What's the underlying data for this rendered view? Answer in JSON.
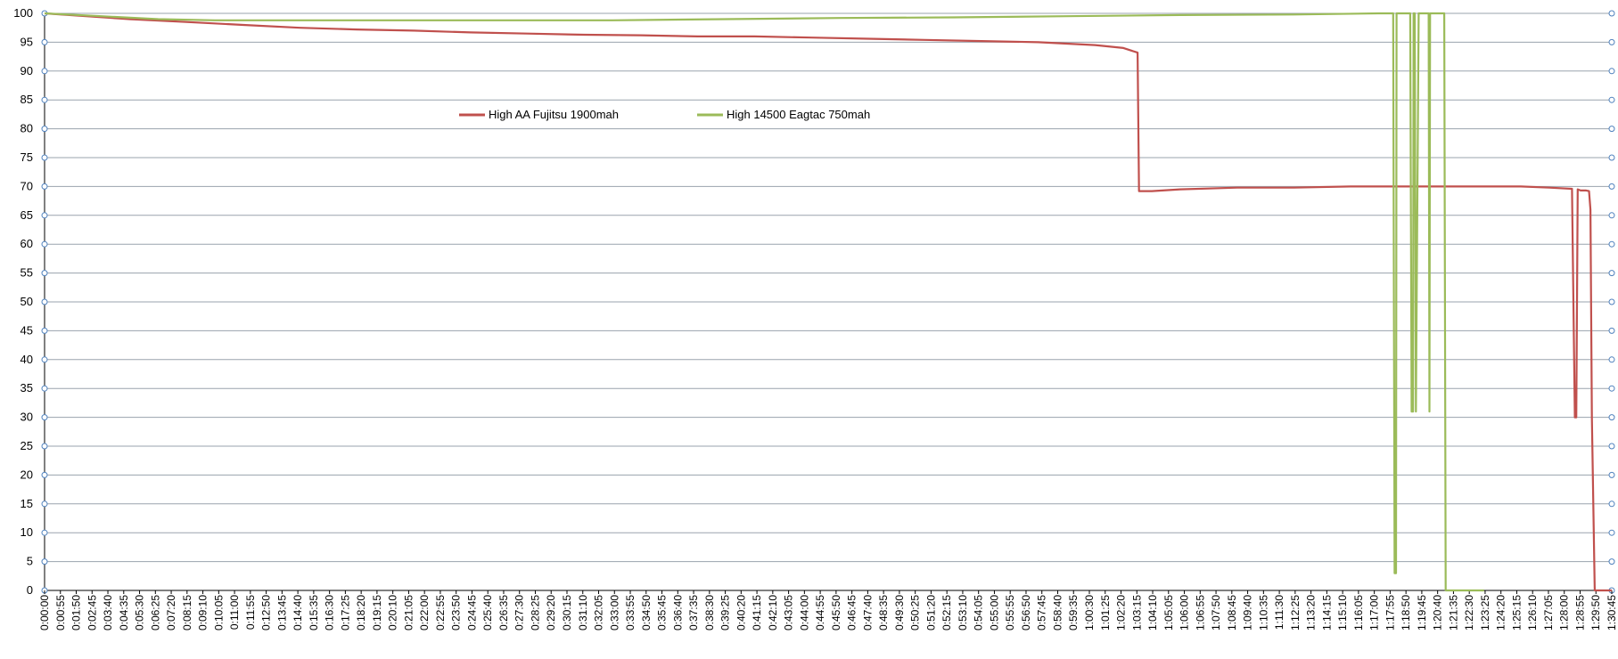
{
  "chart_data": {
    "type": "line",
    "title": "",
    "xlabel": "",
    "ylabel": "",
    "ylim": [
      0,
      100
    ],
    "yticks": [
      0,
      5,
      10,
      15,
      20,
      25,
      30,
      35,
      40,
      45,
      50,
      55,
      60,
      65,
      70,
      75,
      80,
      85,
      90,
      95,
      100
    ],
    "grid": true,
    "legend_position": "top-center",
    "x_unit": "seconds",
    "xlim": [
      0,
      5520
    ],
    "x_tick_labels": [
      "0:00:00",
      "0:00:55",
      "0:01:50",
      "0:02:45",
      "0:03:40",
      "0:04:35",
      "0:05:30",
      "0:06:25",
      "0:07:20",
      "0:08:15",
      "0:09:10",
      "0:10:05",
      "0:11:00",
      "0:11:55",
      "0:12:50",
      "0:13:45",
      "0:14:40",
      "0:15:35",
      "0:16:30",
      "0:17:25",
      "0:18:20",
      "0:19:15",
      "0:20:10",
      "0:21:05",
      "0:22:00",
      "0:22:55",
      "0:23:50",
      "0:24:45",
      "0:25:40",
      "0:26:35",
      "0:27:30",
      "0:28:25",
      "0:29:20",
      "0:30:15",
      "0:31:10",
      "0:32:05",
      "0:33:00",
      "0:33:55",
      "0:34:50",
      "0:35:45",
      "0:36:40",
      "0:37:35",
      "0:38:30",
      "0:39:25",
      "0:40:20",
      "0:41:15",
      "0:42:10",
      "0:43:05",
      "0:44:00",
      "0:44:55",
      "0:45:50",
      "0:46:45",
      "0:47:40",
      "0:48:35",
      "0:49:30",
      "0:50:25",
      "0:51:20",
      "0:52:15",
      "0:53:10",
      "0:54:05",
      "0:55:00",
      "0:55:55",
      "0:56:50",
      "0:57:45",
      "0:58:40",
      "0:59:35",
      "1:00:30",
      "1:01:25",
      "1:02:20",
      "1:03:15",
      "1:04:10",
      "1:05:05",
      "1:06:00",
      "1:06:55",
      "1:07:50",
      "1:08:45",
      "1:09:40",
      "1:10:35",
      "1:11:30",
      "1:12:25",
      "1:13:20",
      "1:14:15",
      "1:15:10",
      "1:16:05",
      "1:17:00",
      "1:17:55",
      "1:18:50",
      "1:19:45",
      "1:20:40",
      "1:21:35",
      "1:22:30",
      "1:23:25",
      "1:24:20",
      "1:25:15",
      "1:26:10",
      "1:27:05",
      "1:28:00",
      "1:28:55",
      "1:29:50",
      "1:30:45"
    ],
    "series": [
      {
        "name": "High AA Fujitsu 1900mah",
        "color": "#c0504d",
        "x": [
          0,
          300,
          500,
          700,
          900,
          1100,
          1300,
          1500,
          1700,
          1900,
          2100,
          2300,
          2500,
          2700,
          2900,
          3100,
          3300,
          3500,
          3700,
          3800,
          3850,
          3855,
          3900,
          4000,
          4200,
          4400,
          4600,
          4800,
          5000,
          5200,
          5300,
          5380,
          5390,
          5395,
          5400,
          5410,
          5430,
          5440,
          5445,
          5450,
          5460,
          5470,
          5520
        ],
        "y": [
          100,
          99,
          98.5,
          98,
          97.5,
          97.2,
          97,
          96.7,
          96.5,
          96.3,
          96.2,
          96,
          96,
          95.8,
          95.6,
          95.4,
          95.2,
          95,
          94.5,
          94,
          93.2,
          69.2,
          69.2,
          69.5,
          69.8,
          69.8,
          70,
          70,
          70,
          70,
          69.8,
          69.6,
          30,
          30,
          69.5,
          69.3,
          69.3,
          69.2,
          66,
          30,
          0,
          0,
          0
        ]
      },
      {
        "name": "High 14500 Eagtac 750mah",
        "color": "#9bbb59",
        "x": [
          0,
          200,
          400,
          600,
          800,
          1200,
          1600,
          2000,
          2400,
          2800,
          3200,
          3600,
          4000,
          4400,
          4700,
          4750,
          4755,
          4760,
          4762,
          4770,
          4810,
          4815,
          4820,
          4822,
          4826,
          4830,
          4840,
          4875,
          4878,
          4880,
          4885,
          4890,
          4930,
          4935,
          4945,
          4950,
          5070,
          5520
        ],
        "y": [
          100,
          99.5,
          99,
          98.8,
          98.8,
          98.8,
          98.8,
          98.8,
          99,
          99.2,
          99.3,
          99.5,
          99.7,
          99.8,
          100,
          100,
          3,
          3,
          100,
          100,
          100,
          31,
          31,
          100,
          100,
          31,
          100,
          100,
          31,
          100,
          100,
          100,
          100,
          0,
          0,
          0,
          0,
          null
        ]
      }
    ]
  }
}
